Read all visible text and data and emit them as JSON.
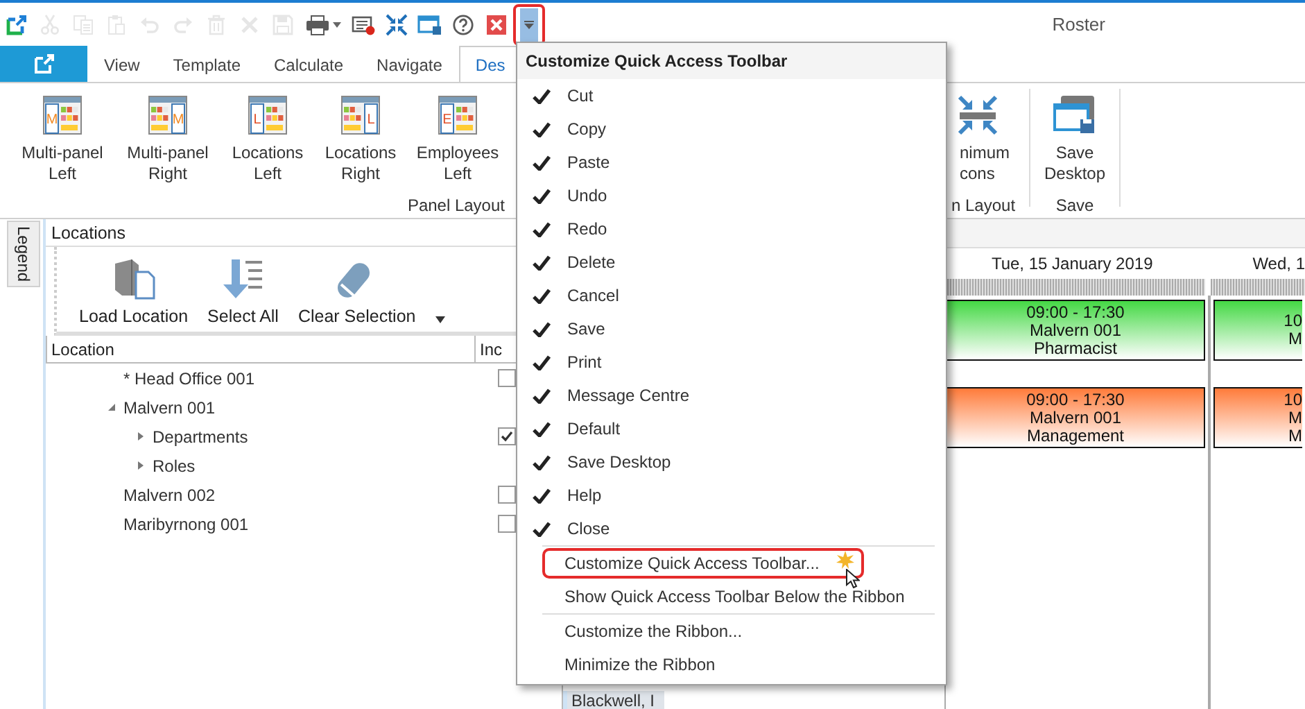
{
  "window": {
    "title": "Roster"
  },
  "quick_access_toolbar": [
    {
      "kind": "app",
      "disabled": false
    },
    {
      "kind": "cut",
      "disabled": true
    },
    {
      "kind": "copy",
      "disabled": true
    },
    {
      "kind": "paste",
      "disabled": true
    },
    {
      "kind": "undo",
      "disabled": true
    },
    {
      "kind": "redo",
      "disabled": true
    },
    {
      "kind": "delete",
      "disabled": true
    },
    {
      "kind": "cancel",
      "disabled": true
    },
    {
      "kind": "save",
      "disabled": true
    },
    {
      "kind": "print",
      "disabled": false
    },
    {
      "kind": "message",
      "disabled": false
    },
    {
      "kind": "default",
      "disabled": false
    },
    {
      "kind": "save-desktop",
      "disabled": false
    },
    {
      "kind": "help",
      "disabled": false
    },
    {
      "kind": "close",
      "disabled": false
    }
  ],
  "customize_button": {
    "highlighted": true
  },
  "tabs": [
    {
      "label": "View",
      "selected": false
    },
    {
      "label": "Template",
      "selected": false
    },
    {
      "label": "Calculate",
      "selected": false
    },
    {
      "label": "Navigate",
      "selected": false
    },
    {
      "label": "Des",
      "selected": true
    }
  ],
  "ribbon": [
    {
      "label": "Panel Layout",
      "buttons": [
        {
          "kind": "panel",
          "lines": [
            "Multi-panel",
            "Left"
          ],
          "icon_letter": "M",
          "panel_right": false
        },
        {
          "kind": "panel",
          "lines": [
            "Multi-panel",
            "Right"
          ],
          "icon_letter": "M",
          "panel_right": true
        },
        {
          "kind": "panel",
          "lines": [
            "Locations",
            "Left"
          ],
          "icon_letter": "L",
          "panel_right": false
        },
        {
          "kind": "panel",
          "lines": [
            "Locations",
            "Right"
          ],
          "icon_letter": "L",
          "panel_right": true
        },
        {
          "kind": "panel",
          "lines": [
            "Employees",
            "Left"
          ],
          "icon_letter": "E",
          "panel_right": false
        }
      ]
    },
    {
      "label": "n Layout",
      "buttons": [
        {
          "kind": "shrink",
          "lines": [
            "nimum",
            "cons"
          ]
        }
      ]
    },
    {
      "label": "Save",
      "buttons": [
        {
          "kind": "save-desktop",
          "lines": [
            "Save",
            "Desktop"
          ]
        }
      ]
    }
  ],
  "legend": {
    "label": "Legend"
  },
  "locations_panel": {
    "title": "Locations",
    "toolbar": [
      {
        "kind": "load",
        "label": "Load Location"
      },
      {
        "kind": "select-all",
        "label": "Select All"
      },
      {
        "kind": "clear",
        "label": "Clear Selection"
      }
    ],
    "columns": [
      "Location",
      "Inc"
    ],
    "tree": [
      {
        "label": "* Head Office 001",
        "checked": false
      },
      {
        "label": "Malvern 001",
        "expanded": true,
        "children": [
          {
            "label": "Departments",
            "expanded": false,
            "checked": true
          },
          {
            "label": "Roles",
            "expanded": false
          }
        ]
      },
      {
        "label": "Malvern 002",
        "checked": false
      },
      {
        "label": "Maribyrnong 001",
        "checked": false
      }
    ]
  },
  "roster": {
    "days": [
      {
        "label": "Tue, 15 January 2019",
        "shifts": [
          {
            "lines": [
              "09:00 - 17:30",
              "Malvern 001",
              "Pharmacist"
            ],
            "color": "#44d844"
          },
          {
            "lines": [
              "09:00 - 17:30",
              "Malvern 001",
              "Management"
            ],
            "color": "#ff7b3a"
          }
        ]
      },
      {
        "label": "Wed, 1",
        "shifts": [
          {
            "lines": [
              "10",
              "M"
            ],
            "color": "#44d844"
          },
          {
            "lines": [
              "10",
              "M",
              "M"
            ],
            "color": "#ff7b3a"
          }
        ]
      }
    ],
    "employees": [
      {
        "name": "Blackwell, I"
      }
    ]
  },
  "menu": {
    "title": "Customize Quick Access Toolbar",
    "sections": [
      {
        "items": [
          {
            "kind": "check",
            "label": "Cut",
            "checked": true
          },
          {
            "kind": "check",
            "label": "Copy",
            "checked": true
          },
          {
            "kind": "check",
            "label": "Paste",
            "checked": true
          },
          {
            "kind": "check",
            "label": "Undo",
            "checked": true
          },
          {
            "kind": "check",
            "label": "Redo",
            "checked": true
          },
          {
            "kind": "check",
            "label": "Delete",
            "checked": true
          },
          {
            "kind": "check",
            "label": "Cancel",
            "checked": true
          },
          {
            "kind": "check",
            "label": "Save",
            "checked": true
          },
          {
            "kind": "check",
            "label": "Print",
            "checked": true
          },
          {
            "kind": "check",
            "label": "Message Centre",
            "checked": true
          },
          {
            "kind": "check",
            "label": "Default",
            "checked": true
          },
          {
            "kind": "check",
            "label": "Save Desktop",
            "checked": true
          },
          {
            "kind": "check",
            "label": "Help",
            "checked": true
          },
          {
            "kind": "check",
            "label": "Close",
            "checked": true
          }
        ]
      },
      {
        "items": [
          {
            "kind": "command",
            "label": "Customize Quick Access Toolbar...",
            "highlighted": true
          },
          {
            "kind": "command",
            "label": "Show Quick Access Toolbar Below the Ribbon",
            "highlighted": false
          }
        ]
      },
      {
        "items": [
          {
            "kind": "command",
            "label": "Customize the Ribbon...",
            "highlighted": false
          },
          {
            "kind": "command",
            "label": "Minimize the Ribbon",
            "highlighted": false
          }
        ]
      }
    ]
  }
}
